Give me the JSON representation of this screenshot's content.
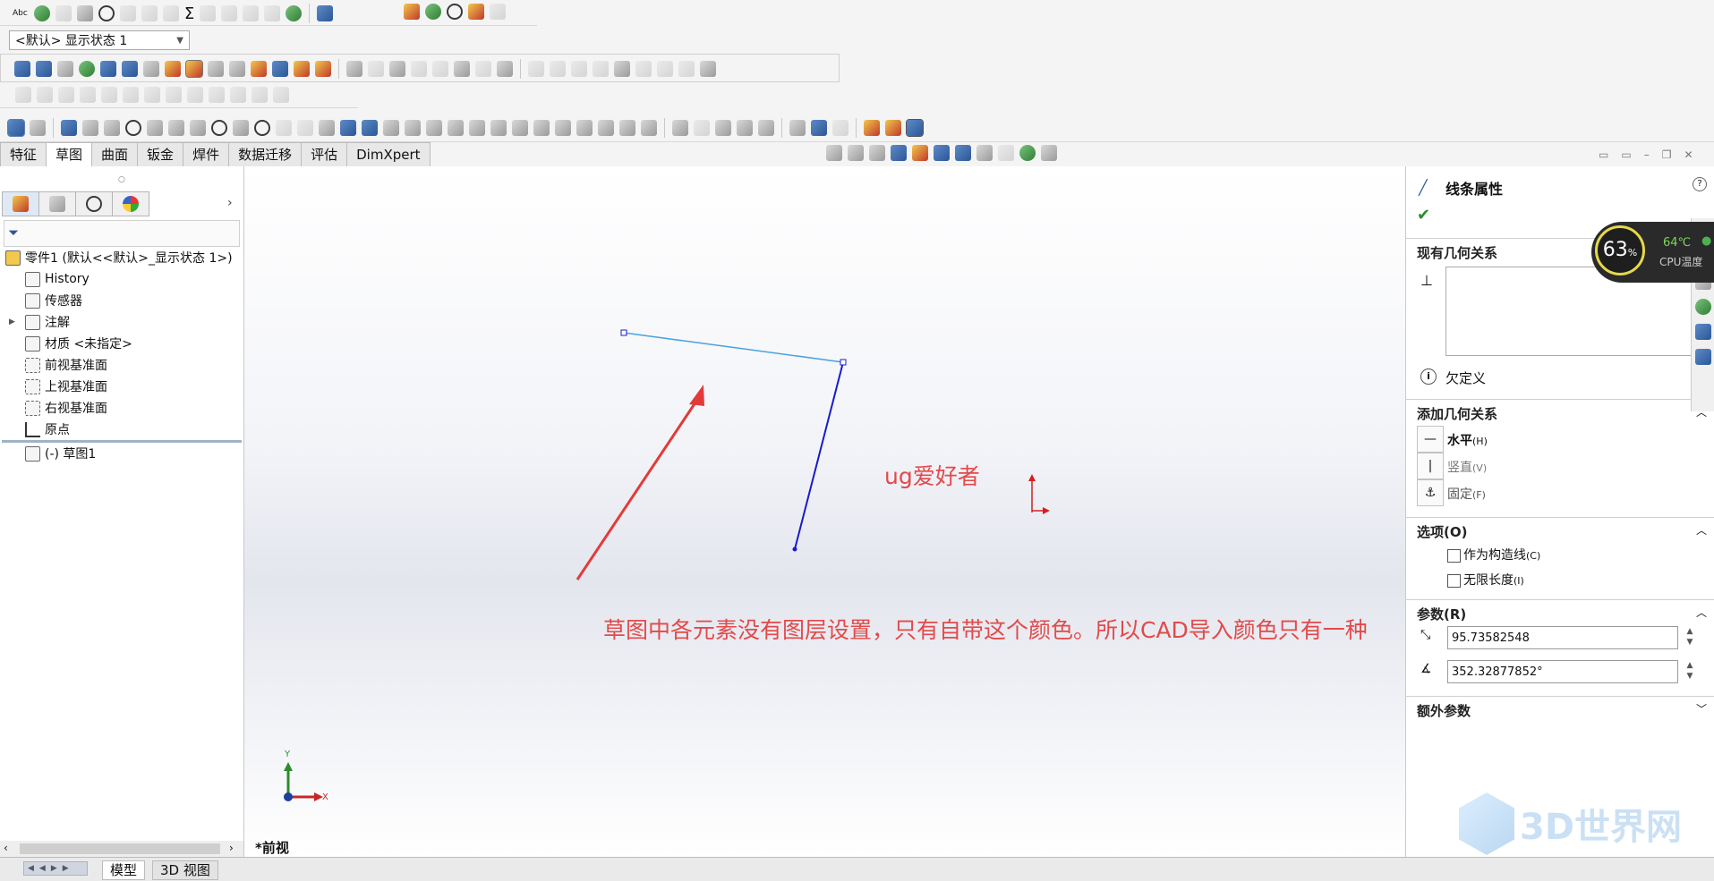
{
  "colors": {
    "annotation": "#e24a4a",
    "sketch_line_light": "#4aa3df",
    "sketch_line_dark": "#1a1acc",
    "origin": "#d31f1f"
  },
  "toolbar": {
    "config_dropdown": "<默认> 显示状态 1",
    "first_row_label": "Abc"
  },
  "command_tabs": [
    "特征",
    "草图",
    "曲面",
    "钣金",
    "焊件",
    "数据迁移",
    "评估",
    "DimXpert"
  ],
  "feature_tree": {
    "root": "零件1 (默认<<默认>_显示状态 1>)",
    "items": [
      "History",
      "传感器",
      "注解",
      "材质 <未指定>",
      "前视基准面",
      "上视基准面",
      "右视基准面",
      "原点",
      "(-) 草图1"
    ]
  },
  "canvas": {
    "annotation_top": "ug爱好者",
    "annotation_bottom": "草图中各元素没有图层设置，只有自带这个颜色。所以CAD导入颜色只有一种",
    "view_label": "*前视",
    "axis_x": "X",
    "axis_y": "Y"
  },
  "property_panel": {
    "title": "线条属性",
    "existing_relations": "现有几何关系",
    "status": "欠定义",
    "add_relations": "添加几何关系",
    "relations": [
      {
        "label": "水平",
        "key": "(H)"
      },
      {
        "label": "竖直",
        "key": "(V)"
      },
      {
        "label": "固定",
        "key": "(F)"
      }
    ],
    "options": "选项(O)",
    "option_items": [
      {
        "label": "作为构造线",
        "key": "(C)"
      },
      {
        "label": "无限长度",
        "key": "(I)"
      }
    ],
    "parameters": "参数(R)",
    "length_value": "95.73582548",
    "angle_value": "352.32877852°",
    "extra_params": "额外参数"
  },
  "cpu_widget": {
    "percent": "63",
    "percent_sign": "%",
    "temp": "64℃",
    "label": "CPU温度"
  },
  "bottom_tabs": [
    "模型",
    "3D 视图"
  ],
  "watermark": "3D世界网"
}
